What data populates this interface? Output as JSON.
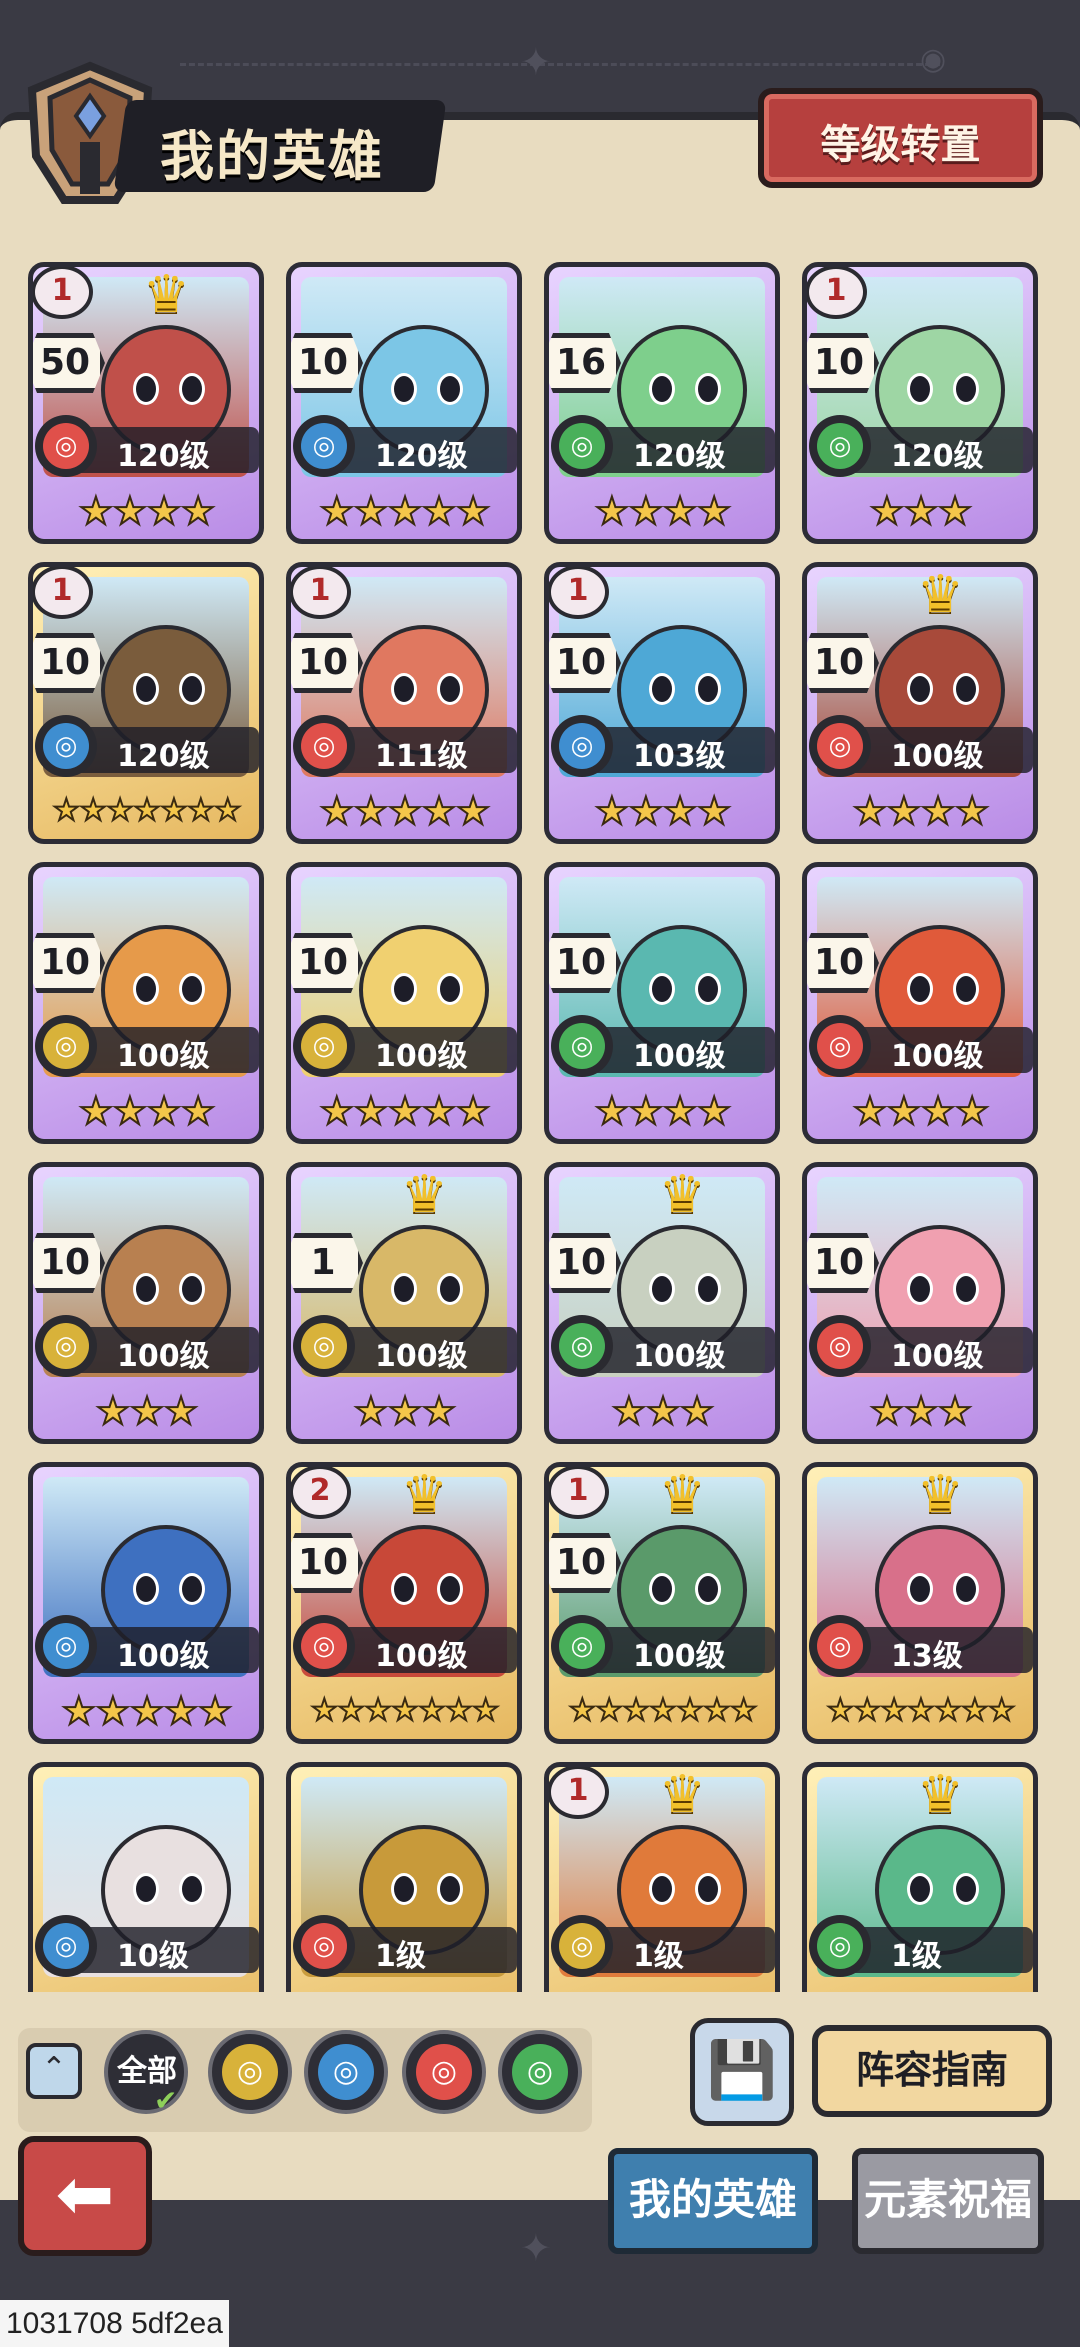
{
  "header": {
    "title": "我的英雄",
    "level_reset_label": "等级转置"
  },
  "heroes": [
    {
      "level": "120级",
      "count": "50",
      "tier": "1",
      "crown": true,
      "element": "fire",
      "stars": 4,
      "frame": "purple",
      "portrait": "#c0504a"
    },
    {
      "level": "120级",
      "count": "10",
      "tier": "",
      "crown": false,
      "element": "water",
      "stars": 5,
      "frame": "purple",
      "portrait": "#7cc6e6"
    },
    {
      "level": "120级",
      "count": "16",
      "tier": "",
      "crown": false,
      "element": "wind",
      "stars": 4,
      "frame": "purple",
      "portrait": "#7ecf8c"
    },
    {
      "level": "120级",
      "count": "10",
      "tier": "1",
      "crown": false,
      "element": "wind",
      "stars": 3,
      "frame": "purple",
      "portrait": "#9ed6a4"
    },
    {
      "level": "120级",
      "count": "10",
      "tier": "1",
      "crown": false,
      "element": "water",
      "stars": 7,
      "frame": "gold",
      "portrait": "#7a5c3c"
    },
    {
      "level": "111级",
      "count": "10",
      "tier": "1",
      "crown": false,
      "element": "fire",
      "stars": 5,
      "frame": "purple",
      "portrait": "#e07860"
    },
    {
      "level": "103级",
      "count": "10",
      "tier": "1",
      "crown": false,
      "element": "water",
      "stars": 4,
      "frame": "purple",
      "portrait": "#4ea8d6"
    },
    {
      "level": "100级",
      "count": "10",
      "tier": "",
      "crown": true,
      "element": "fire",
      "stars": 4,
      "frame": "purple",
      "portrait": "#a84a3a"
    },
    {
      "level": "100级",
      "count": "10",
      "tier": "",
      "crown": false,
      "element": "earth",
      "stars": 4,
      "frame": "purple",
      "portrait": "#e69a4a"
    },
    {
      "level": "100级",
      "count": "10",
      "tier": "",
      "crown": false,
      "element": "earth",
      "stars": 5,
      "frame": "purple",
      "portrait": "#f0d070"
    },
    {
      "level": "100级",
      "count": "10",
      "tier": "",
      "crown": false,
      "element": "wind",
      "stars": 4,
      "frame": "purple",
      "portrait": "#5ab8b0"
    },
    {
      "level": "100级",
      "count": "10",
      "tier": "",
      "crown": false,
      "element": "fire",
      "stars": 4,
      "frame": "purple",
      "portrait": "#e05a3a"
    },
    {
      "level": "100级",
      "count": "10",
      "tier": "",
      "crown": false,
      "element": "earth",
      "stars": 3,
      "frame": "purple",
      "portrait": "#b88050"
    },
    {
      "level": "100级",
      "count": "1",
      "tier": "",
      "crown": true,
      "element": "earth",
      "stars": 3,
      "frame": "purple",
      "portrait": "#d8b868"
    },
    {
      "level": "100级",
      "count": "10",
      "tier": "",
      "crown": true,
      "element": "wind",
      "stars": 3,
      "frame": "purple",
      "portrait": "#c8d0c0"
    },
    {
      "level": "100级",
      "count": "10",
      "tier": "",
      "crown": false,
      "element": "fire",
      "stars": 3,
      "frame": "purple",
      "portrait": "#f0a0b0"
    },
    {
      "level": "100级",
      "count": "",
      "tier": "",
      "crown": false,
      "element": "water",
      "stars": 5,
      "frame": "purple",
      "portrait": "#3e70c0"
    },
    {
      "level": "100级",
      "count": "10",
      "tier": "2",
      "crown": true,
      "element": "fire",
      "stars": 7,
      "frame": "gold",
      "portrait": "#c84838"
    },
    {
      "level": "100级",
      "count": "10",
      "tier": "1",
      "crown": true,
      "element": "wind",
      "stars": 7,
      "frame": "gold",
      "portrait": "#5a9a6a"
    },
    {
      "level": "13级",
      "count": "",
      "tier": "",
      "crown": true,
      "element": "fire",
      "stars": 7,
      "frame": "gold",
      "portrait": "#d8708a"
    },
    {
      "level": "10级",
      "count": "",
      "tier": "",
      "crown": false,
      "element": "water",
      "stars": 0,
      "frame": "gold",
      "portrait": "#e8e0e0"
    },
    {
      "level": "1级",
      "count": "",
      "tier": "",
      "crown": false,
      "element": "fire",
      "stars": 0,
      "frame": "gold",
      "portrait": "#c89a3a"
    },
    {
      "level": "1级",
      "count": "",
      "tier": "1",
      "crown": true,
      "element": "earth",
      "stars": 0,
      "frame": "gold",
      "portrait": "#e07a3a"
    },
    {
      "level": "1级",
      "count": "",
      "tier": "",
      "crown": true,
      "element": "wind",
      "stars": 0,
      "frame": "gold",
      "portrait": "#5ab88a"
    }
  ],
  "element_colors": {
    "fire": "#e0504a",
    "water": "#3f8ed0",
    "wind": "#49b05a",
    "earth": "#d8b23a"
  },
  "filters": {
    "all_label": "全部",
    "items": [
      "earth",
      "water",
      "fire",
      "wind"
    ]
  },
  "footer": {
    "lineup_guide_label": "阵容指南",
    "tab_my_heroes": "我的英雄",
    "tab_element_blessing": "元素祝福",
    "debug_id": "1031708 5df2ea"
  }
}
